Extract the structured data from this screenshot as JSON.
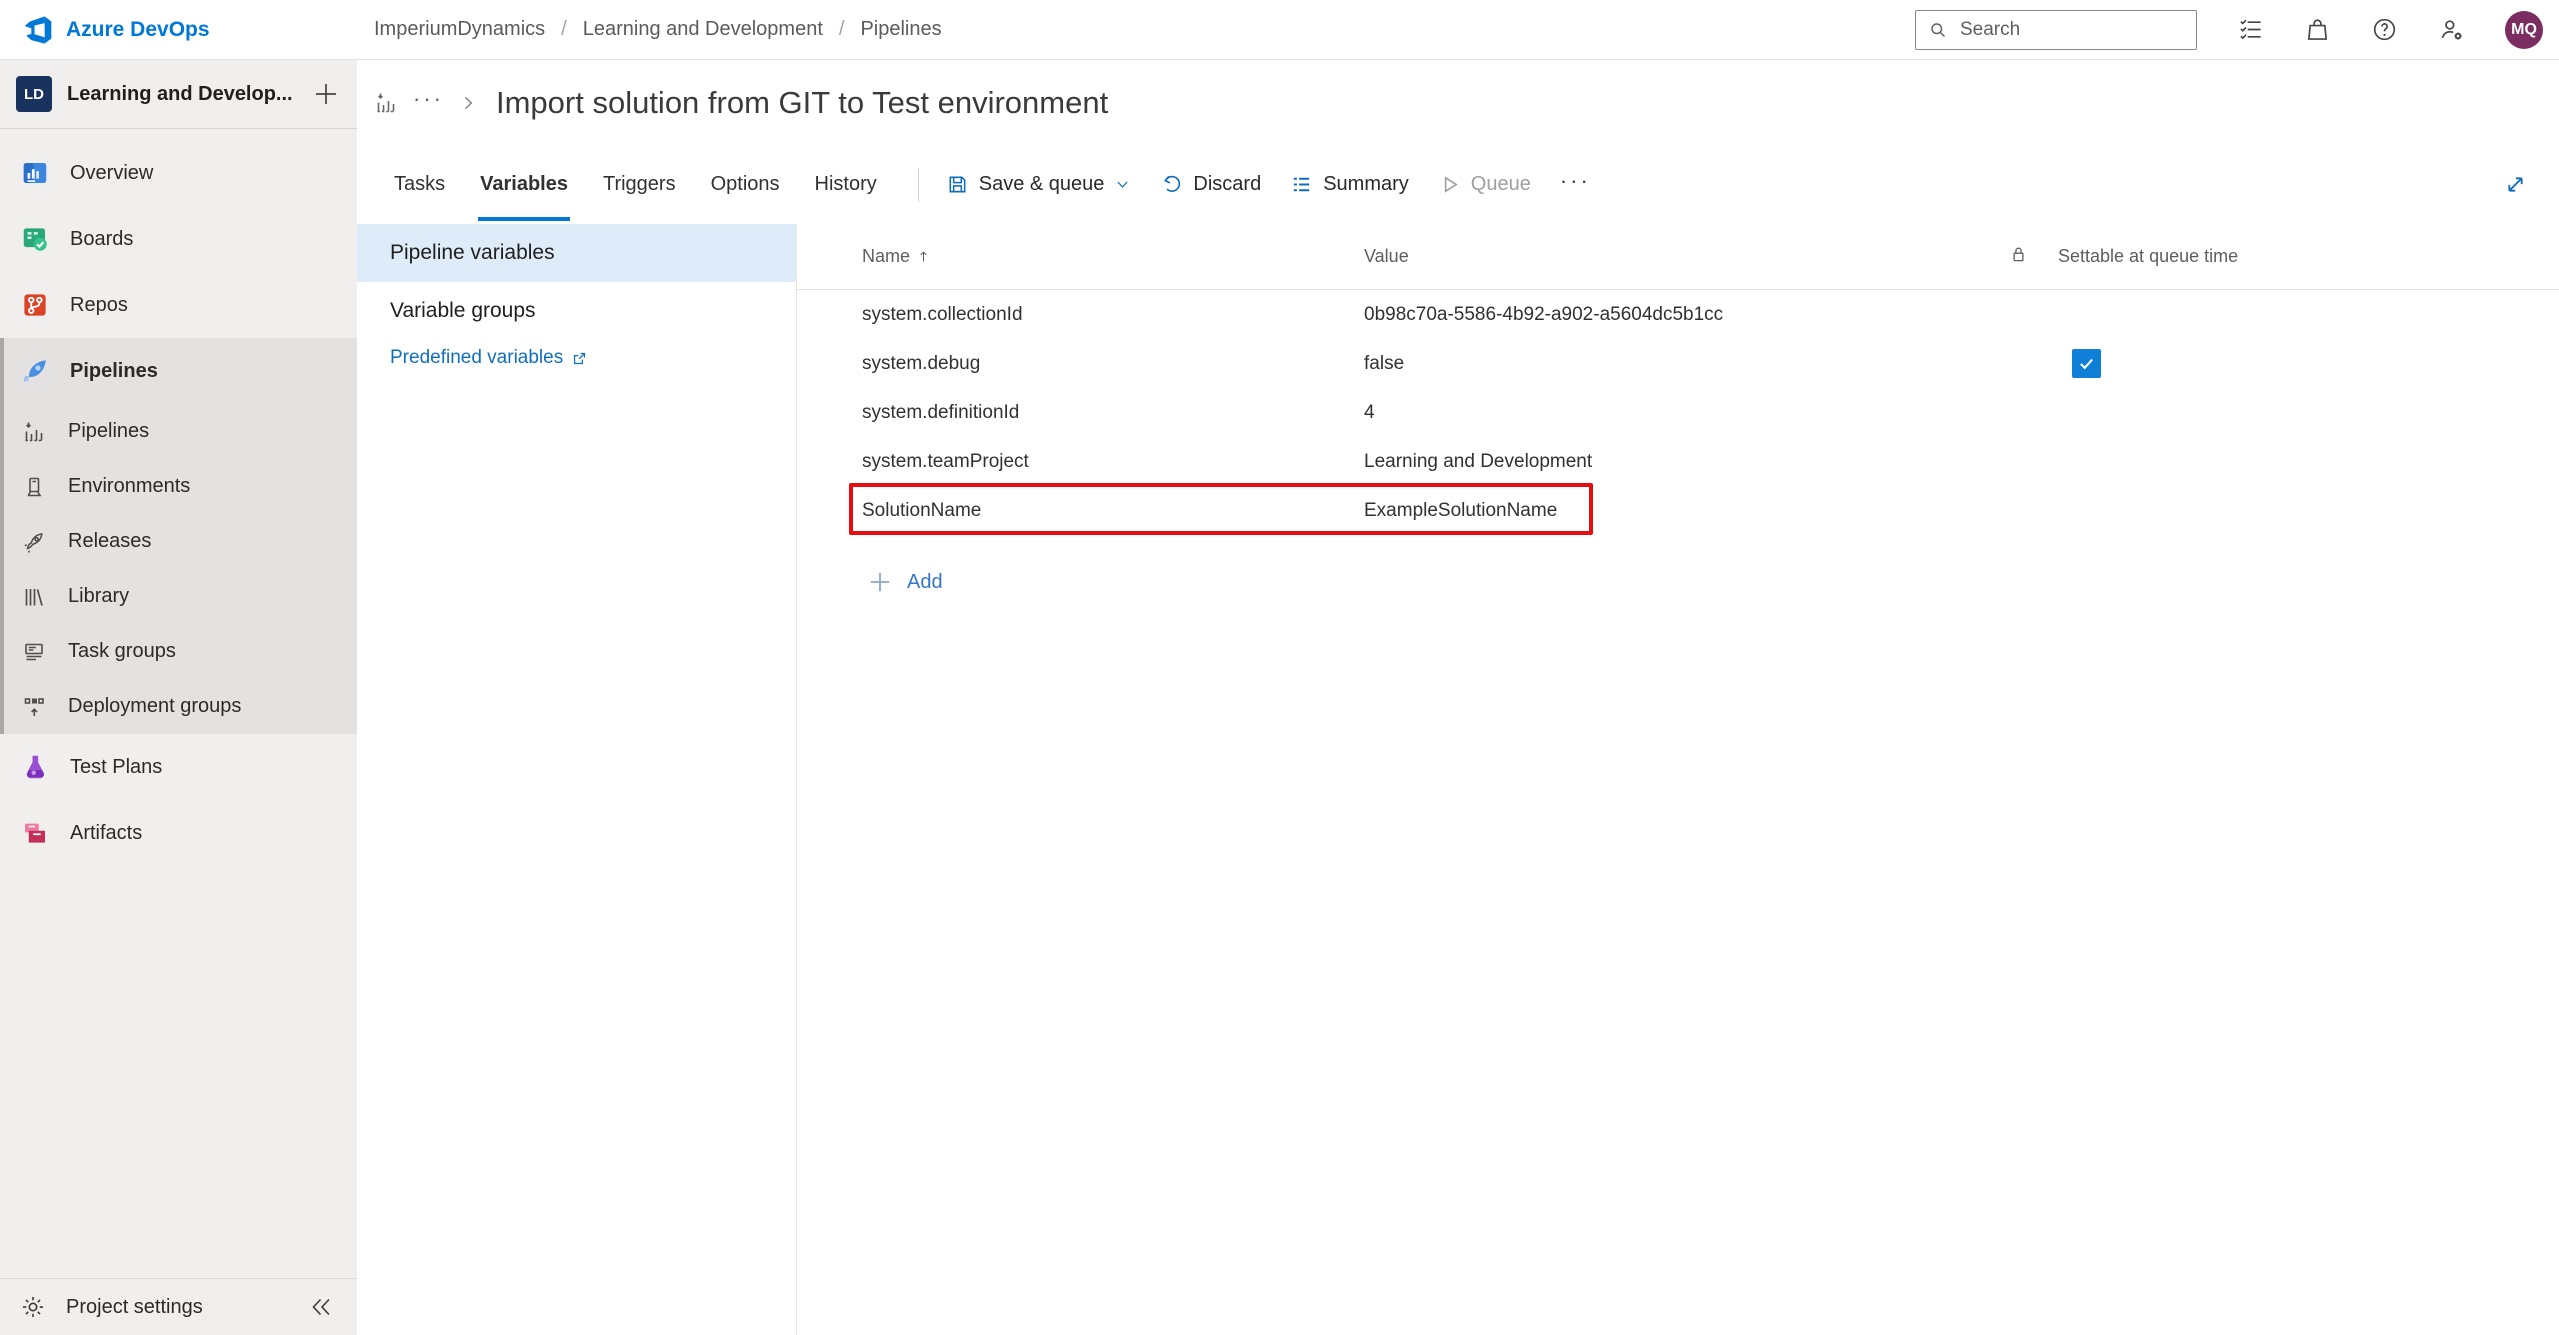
{
  "colors": {
    "accent_blue": "#0078d4",
    "brand_blue": "#0078d7",
    "tab_underline": "#0078d4",
    "checkbox_blue": "#0f7fd7",
    "highlight_red": "#e50d0d",
    "selected_pane_item_bg": "#deecf9",
    "sidebar_bg": "#f0efee",
    "sidebar_section_bg": "#e4e2e1",
    "avatar_bg": "#7b2d62",
    "link_blue": "#106ebe"
  },
  "top_bar": {
    "brand": "Azure DevOps",
    "breadcrumb": [
      {
        "label": "ImperiumDynamics"
      },
      {
        "label": "Learning and Development"
      },
      {
        "label": "Pipelines"
      }
    ],
    "breadcrumb_separator": "/",
    "search_placeholder": "Search",
    "avatar_initials": "MQ"
  },
  "sidebar": {
    "project": {
      "initials": "LD",
      "name": "Learning and Develop..."
    },
    "items": [
      {
        "label": "Overview"
      },
      {
        "label": "Boards"
      },
      {
        "label": "Repos"
      },
      {
        "label": "Pipelines",
        "selected": true
      }
    ],
    "sub_items": [
      {
        "label": "Pipelines"
      },
      {
        "label": "Environments"
      },
      {
        "label": "Releases"
      },
      {
        "label": "Library"
      },
      {
        "label": "Task groups"
      },
      {
        "label": "Deployment groups"
      }
    ],
    "lower_items": [
      {
        "label": "Test Plans"
      },
      {
        "label": "Artifacts"
      }
    ],
    "footer_label": "Project settings"
  },
  "page": {
    "title": "Import solution from GIT to Test environment",
    "title_more": "···",
    "tabs": [
      {
        "label": "Tasks"
      },
      {
        "label": "Variables",
        "active": true
      },
      {
        "label": "Triggers"
      },
      {
        "label": "Options"
      },
      {
        "label": "History"
      }
    ],
    "toolbar": {
      "save_label": "Save & queue",
      "discard_label": "Discard",
      "summary_label": "Summary",
      "queue_label": "Queue",
      "queue_disabled": true,
      "more": "···"
    }
  },
  "variables_pane": {
    "items": [
      {
        "label": "Pipeline variables",
        "selected": true
      },
      {
        "label": "Variable groups"
      }
    ],
    "link_label": "Predefined variables"
  },
  "table": {
    "header": {
      "name": "Name",
      "value": "Value",
      "settable": "Settable at queue time"
    },
    "rows": [
      {
        "name": "system.collectionId",
        "value": "0b98c70a-5586-4b92-a902-a5604dc5b1cc",
        "settable_checked": false
      },
      {
        "name": "system.debug",
        "value": "false",
        "settable_checked": true
      },
      {
        "name": "system.definitionId",
        "value": "4",
        "settable_checked": false
      },
      {
        "name": "system.teamProject",
        "value": "Learning and Development",
        "settable_checked": false
      },
      {
        "name": "SolutionName",
        "value": "ExampleSolutionName",
        "settable_checked": false,
        "highlighted": true
      }
    ],
    "add_label": "Add"
  },
  "icons": {
    "azure-devops-logo": "devops infinity mark",
    "search-icon": "magnifier",
    "task-list-icon": "checklist lines",
    "marketplace-bag-icon": "shopping bag",
    "help-icon": "question circle",
    "user-settings-icon": "person with gear",
    "plus-icon": "+",
    "gear-icon": "cog",
    "collapse-icon": "double chevron left",
    "sort-asc-icon": "up arrow",
    "lock-icon": "padlock",
    "external-link-icon": "box with NE arrow",
    "save-icon": "floppy disk",
    "undo-icon": "curved back arrow",
    "summary-icon": "list lines",
    "queue-play-icon": "play triangle outline",
    "expand-icon": "diagonal resize arrows",
    "chevron-down-icon": "v",
    "chevron-right-icon": ">",
    "checkmark-icon": "check"
  }
}
